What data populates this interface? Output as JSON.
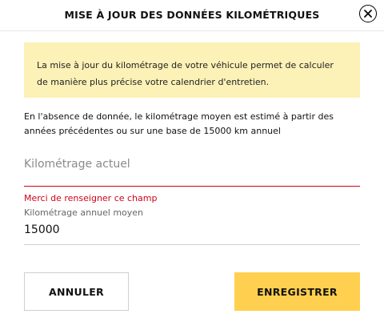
{
  "dialog": {
    "title": "MISE À JOUR DES DONNÉES KILOMÉTRIQUES",
    "close_icon": "close-circle-icon"
  },
  "notice": {
    "text_line1": "La mise à jour du kilométrage de votre véhicule permet de calculer",
    "text_line2": "de manière plus précise votre calendrier d'entretien.",
    "background": "#fcf1b6"
  },
  "info": {
    "line1": "En l'absence de donnée, le kilométrage moyen est estimé à partir des",
    "line2": "années précédentes ou sur une base de 15000 km annuel"
  },
  "current_mileage": {
    "placeholder": "Kilométrage actuel",
    "value": "",
    "error": "Merci de renseigner ce champ",
    "error_color": "#d0021b"
  },
  "annual_mileage": {
    "label": "Kilométrage annuel moyen",
    "value": "15000"
  },
  "buttons": {
    "cancel": "ANNULER",
    "save": "ENREGISTRER",
    "save_color": "#ffd04f"
  }
}
